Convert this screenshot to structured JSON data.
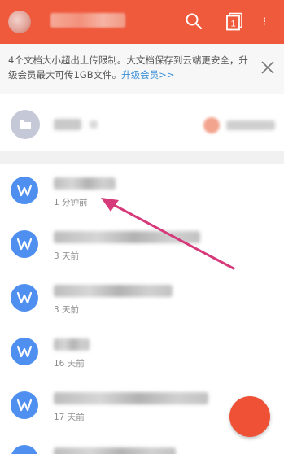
{
  "header": {
    "title": "",
    "accent_color": "#ef5a3d"
  },
  "banner": {
    "message": "4个文档大小超出上传限制。大文档保存到云端更安全，升级会员最大可传1GB文件。",
    "upgrade_link": "升级会员>>"
  },
  "folder": {
    "name": "",
    "share_label": ""
  },
  "files": [
    {
      "name": "",
      "time": "1 分钟前"
    },
    {
      "name": "",
      "time": "3 天前"
    },
    {
      "name": "",
      "time": "3 天前"
    },
    {
      "name": "",
      "time": "16 天前"
    },
    {
      "name": "",
      "time": "17 天前"
    }
  ],
  "icons": {
    "search": "search-icon",
    "tabs": "tabs-icon",
    "tabs_count": "1",
    "more": "more-vertical-icon",
    "close": "close-icon",
    "folder": "folder-icon",
    "doc": "wps-writer-icon"
  },
  "colors": {
    "file_icon": "#4f8ff0",
    "link": "#3a8fd8",
    "annotation_arrow": "#d63a7a",
    "fab": "#ee5136"
  }
}
